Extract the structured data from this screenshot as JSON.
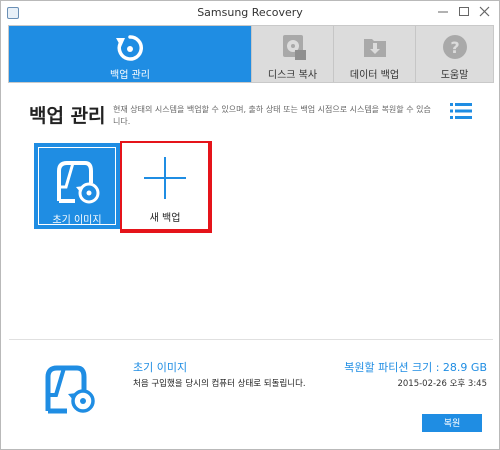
{
  "window": {
    "title": "Samsung Recovery"
  },
  "tabs": [
    {
      "label": "백업 관리",
      "icon": "backup-restore-icon",
      "active": true
    },
    {
      "label": "디스크 복사",
      "icon": "disk-copy-icon",
      "active": false
    },
    {
      "label": "데이터 백업",
      "icon": "data-backup-icon",
      "active": false
    },
    {
      "label": "도움말",
      "icon": "help-icon",
      "active": false
    }
  ],
  "main": {
    "title": "백업 관리",
    "description": "현재 상태의 시스템을 백업할 수 있으며, 출하 상태 또는 백업 시점으로 시스템을 복원할 수 있습니다.",
    "tiles": [
      {
        "label": "초기 이미지",
        "icon": "initial-image-icon",
        "selected": true
      },
      {
        "label": "새 백업",
        "icon": "plus-icon",
        "highlighted": true
      }
    ]
  },
  "info": {
    "name": "초기 이미지",
    "description": "처음 구입했을 당시의 컴퓨터 상태로 되돌립니다.",
    "size": "복원할 파티션 크기 : 28.9 GB",
    "date": "2015-02-26 오후 3:45",
    "restore_button": "복원"
  },
  "colors": {
    "accent": "#1f8de3",
    "highlight_frame": "#e5141a",
    "tab_bar": "#dcdcdc"
  }
}
